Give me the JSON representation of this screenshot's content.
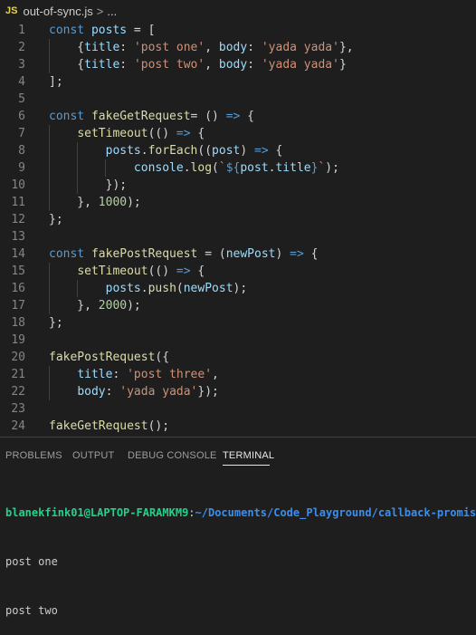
{
  "breadcrumb": {
    "lang_badge": "JS",
    "file": "out-of-sync.js",
    "separator": ">",
    "ellipsis": "..."
  },
  "editor": {
    "lines": [
      {
        "n": "1",
        "tokens": [
          [
            "kw",
            "const "
          ],
          [
            "var",
            "posts"
          ],
          [
            "pun",
            " = ["
          ]
        ]
      },
      {
        "n": "2",
        "tokens": [
          [
            "pun",
            "    {"
          ],
          [
            "var",
            "title"
          ],
          [
            "pun",
            ": "
          ],
          [
            "str",
            "'post one'"
          ],
          [
            "pun",
            ", "
          ],
          [
            "var",
            "body"
          ],
          [
            "pun",
            ": "
          ],
          [
            "str",
            "'yada yada'"
          ],
          [
            "pun",
            "},"
          ]
        ]
      },
      {
        "n": "3",
        "tokens": [
          [
            "pun",
            "    {"
          ],
          [
            "var",
            "title"
          ],
          [
            "pun",
            ": "
          ],
          [
            "str",
            "'post two'"
          ],
          [
            "pun",
            ", "
          ],
          [
            "var",
            "body"
          ],
          [
            "pun",
            ": "
          ],
          [
            "str",
            "'yada yada'"
          ],
          [
            "pun",
            "}"
          ]
        ]
      },
      {
        "n": "4",
        "tokens": [
          [
            "pun",
            "];"
          ]
        ]
      },
      {
        "n": "5",
        "tokens": []
      },
      {
        "n": "6",
        "tokens": [
          [
            "kw",
            "const "
          ],
          [
            "fn",
            "fakeGetRequest"
          ],
          [
            "pun",
            "= () "
          ],
          [
            "kw",
            "=>"
          ],
          [
            "pun",
            " {"
          ]
        ]
      },
      {
        "n": "7",
        "tokens": [
          [
            "pun",
            "    "
          ],
          [
            "fn",
            "setTimeout"
          ],
          [
            "pun",
            "(() "
          ],
          [
            "kw",
            "=>"
          ],
          [
            "pun",
            " {"
          ]
        ]
      },
      {
        "n": "8",
        "tokens": [
          [
            "pun",
            "        "
          ],
          [
            "var",
            "posts"
          ],
          [
            "pun",
            "."
          ],
          [
            "fn",
            "forEach"
          ],
          [
            "pun",
            "(("
          ],
          [
            "var",
            "post"
          ],
          [
            "pun",
            ") "
          ],
          [
            "kw",
            "=>"
          ],
          [
            "pun",
            " {"
          ]
        ]
      },
      {
        "n": "9",
        "tokens": [
          [
            "pun",
            "            "
          ],
          [
            "var",
            "console"
          ],
          [
            "pun",
            "."
          ],
          [
            "fn",
            "log"
          ],
          [
            "pun",
            "("
          ],
          [
            "tpl",
            "`"
          ],
          [
            "kw",
            "${"
          ],
          [
            "var",
            "post"
          ],
          [
            "pun",
            "."
          ],
          [
            "var",
            "title"
          ],
          [
            "kw",
            "}"
          ],
          [
            "tpl",
            "`"
          ],
          [
            "pun",
            ");"
          ]
        ]
      },
      {
        "n": "10",
        "tokens": [
          [
            "pun",
            "        });"
          ]
        ]
      },
      {
        "n": "11",
        "tokens": [
          [
            "pun",
            "    }, "
          ],
          [
            "num",
            "1000"
          ],
          [
            "pun",
            ");"
          ]
        ]
      },
      {
        "n": "12",
        "tokens": [
          [
            "pun",
            "};"
          ]
        ]
      },
      {
        "n": "13",
        "tokens": []
      },
      {
        "n": "14",
        "tokens": [
          [
            "kw",
            "const "
          ],
          [
            "fn",
            "fakePostRequest"
          ],
          [
            "pun",
            " = ("
          ],
          [
            "var",
            "newPost"
          ],
          [
            "pun",
            ") "
          ],
          [
            "kw",
            "=>"
          ],
          [
            "pun",
            " {"
          ]
        ]
      },
      {
        "n": "15",
        "tokens": [
          [
            "pun",
            "    "
          ],
          [
            "fn",
            "setTimeout"
          ],
          [
            "pun",
            "(() "
          ],
          [
            "kw",
            "=>"
          ],
          [
            "pun",
            " {"
          ]
        ]
      },
      {
        "n": "16",
        "tokens": [
          [
            "pun",
            "        "
          ],
          [
            "var",
            "posts"
          ],
          [
            "pun",
            "."
          ],
          [
            "fn",
            "push"
          ],
          [
            "pun",
            "("
          ],
          [
            "var",
            "newPost"
          ],
          [
            "pun",
            ");"
          ]
        ]
      },
      {
        "n": "17",
        "tokens": [
          [
            "pun",
            "    }, "
          ],
          [
            "num",
            "2000"
          ],
          [
            "pun",
            ");"
          ]
        ]
      },
      {
        "n": "18",
        "tokens": [
          [
            "pun",
            "};"
          ]
        ]
      },
      {
        "n": "19",
        "tokens": []
      },
      {
        "n": "20",
        "tokens": [
          [
            "fn",
            "fakePostRequest"
          ],
          [
            "pun",
            "({"
          ]
        ]
      },
      {
        "n": "21",
        "tokens": [
          [
            "pun",
            "    "
          ],
          [
            "var",
            "title"
          ],
          [
            "pun",
            ": "
          ],
          [
            "str",
            "'post three'"
          ],
          [
            "pun",
            ","
          ]
        ]
      },
      {
        "n": "22",
        "tokens": [
          [
            "pun",
            "    "
          ],
          [
            "var",
            "body"
          ],
          [
            "pun",
            ": "
          ],
          [
            "str",
            "'yada yada'"
          ],
          [
            "pun",
            "});"
          ]
        ]
      },
      {
        "n": "23",
        "tokens": []
      },
      {
        "n": "24",
        "tokens": [
          [
            "fn",
            "fakeGetRequest"
          ],
          [
            "pun",
            "();"
          ]
        ]
      }
    ]
  },
  "panel": {
    "tabs": [
      "PROBLEMS",
      "OUTPUT",
      "DEBUG CONSOLE",
      "TERMINAL"
    ],
    "active_tab": "TERMINAL"
  },
  "terminal": {
    "user_host": "blanekfink01@LAPTOP-FARAMKM9",
    "colon": ":",
    "path": "~/Documents/Code_Playground/callback-promise-a",
    "output": [
      "post one",
      "post two"
    ]
  },
  "colors": {
    "background": "#1e1e1e",
    "keyword": "#569cd6",
    "variable": "#9cdcfe",
    "function": "#dcdcaa",
    "string": "#ce9178",
    "number": "#b5cea8",
    "terminal_user": "#23d18b",
    "terminal_path": "#3b8eea"
  }
}
